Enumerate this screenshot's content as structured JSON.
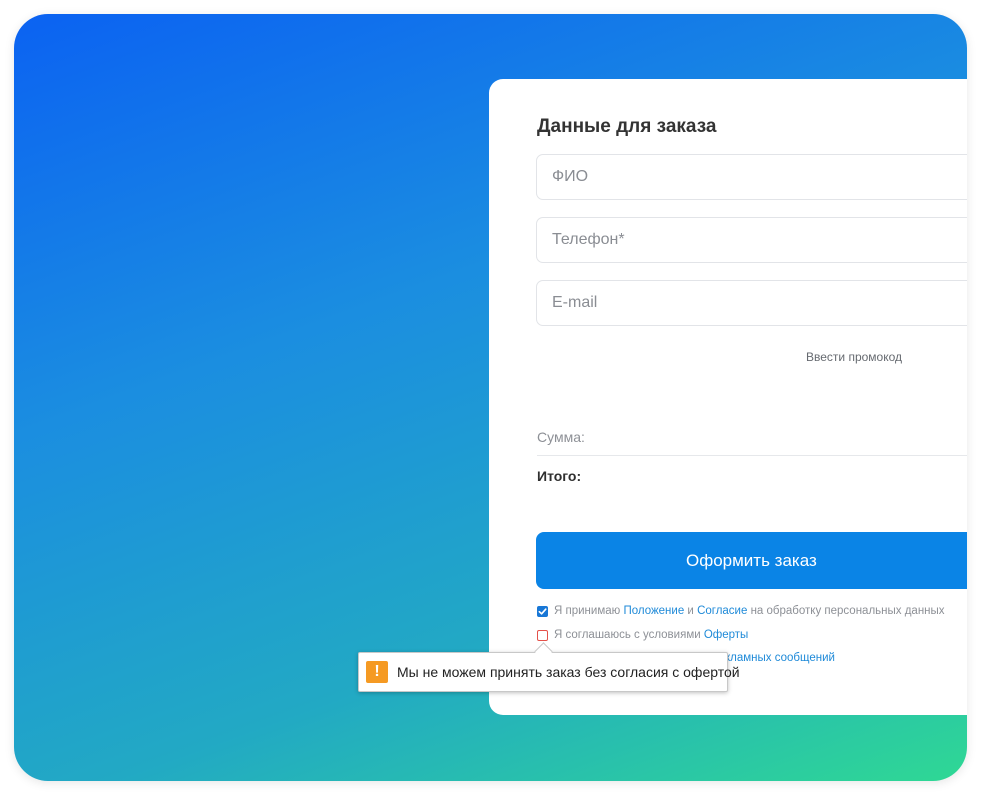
{
  "form": {
    "title": "Данные для заказа",
    "name_placeholder": "ФИО",
    "phone_placeholder": "Телефон*",
    "email_placeholder": "E-mail",
    "promo_link": "Ввести промокод",
    "sum_label": "Сумма:",
    "total_label": "Итого:",
    "submit_label": "Оформить заказ"
  },
  "consents": {
    "personal_data": {
      "checked": true,
      "prefix": "Я принимаю ",
      "link1": "Положение",
      "middle": " и ",
      "link2": "Согласие",
      "suffix": " на обработку персональных данных"
    },
    "offer": {
      "checked": false,
      "prefix": "Я соглашаюсь с условиями ",
      "link": "Оферты"
    },
    "ads": {
      "visible_link_part": "кламных сообщений"
    }
  },
  "validation": {
    "icon": "warning-icon",
    "icon_glyph": "!",
    "message": "Мы не можем принять заказ без согласия с офертой"
  },
  "colors": {
    "accent": "#0a84e6",
    "link": "#1f8ad8",
    "warning": "#f59a23",
    "error_border": "#e4514a"
  }
}
